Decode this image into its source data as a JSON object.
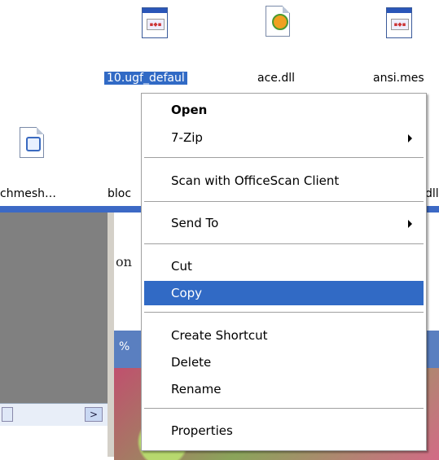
{
  "desktop": {
    "icons": [
      {
        "label": "10.ugf_defaul",
        "selected": true,
        "icon": "app-window-icon"
      },
      {
        "label": "ace.dll",
        "selected": false,
        "icon": "dll-gear-icon"
      },
      {
        "label": "ansi.mes",
        "selected": false,
        "icon": "app-window-icon"
      },
      {
        "label": "chmesh…",
        "selected": false,
        "icon": "java-file-icon"
      },
      {
        "label": "bloc",
        "selected": false,
        "icon": "file-icon"
      },
      {
        "label": "dll",
        "selected": false,
        "icon": "file-icon"
      }
    ]
  },
  "background": {
    "doc_text": "on",
    "tool_text": "%",
    "scroll_right_glyph": ">"
  },
  "context_menu": {
    "items": [
      {
        "label": "Open",
        "bold": true
      },
      {
        "label": "7-Zip",
        "submenu": true
      },
      {
        "label": "Scan with OfficeScan Client"
      },
      {
        "label": "Send To",
        "submenu": true
      },
      {
        "label": "Cut"
      },
      {
        "label": "Copy",
        "highlighted": true
      },
      {
        "label": "Create Shortcut"
      },
      {
        "label": "Delete"
      },
      {
        "label": "Rename"
      },
      {
        "label": "Properties"
      }
    ]
  },
  "colors": {
    "selection": "#316ac5",
    "desktop": "#ffffff",
    "menu_border": "#a0a0a0"
  }
}
